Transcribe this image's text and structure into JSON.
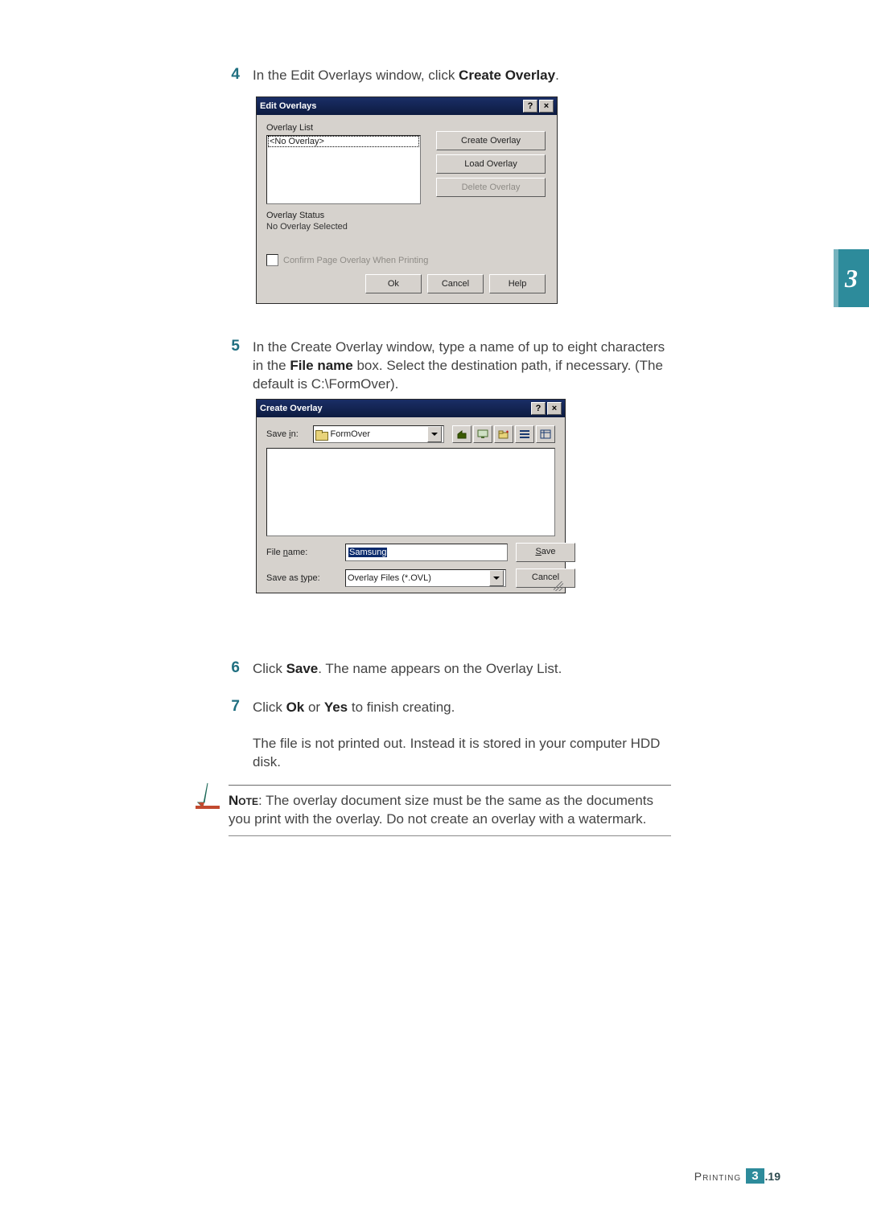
{
  "chapter_tab": "3",
  "steps": {
    "s4": {
      "num": "4",
      "text_pre": "In the Edit Overlays window, click ",
      "bold": "Create Overlay",
      "text_post": "."
    },
    "s5": {
      "num": "5",
      "text_pre": "In the Create Overlay window, type a name of up to eight characters in the ",
      "bold": "File name",
      "text_post": " box. Select the destination path, if necessary. (The default is C:\\FormOver)."
    },
    "s6": {
      "num": "6",
      "text_pre": "Click ",
      "bold": "Save",
      "text_post": ". The name appears on the Overlay List."
    },
    "s7": {
      "num": "7",
      "text_pre": "Click ",
      "bold1": "Ok",
      "mid": " or ",
      "bold2": "Yes",
      "text_post": " to finish creating."
    },
    "s7b": {
      "text": "The file is not printed out. Instead it is stored in your computer HDD disk."
    }
  },
  "dlg1": {
    "title": "Edit Overlays",
    "overlay_list_label": "Overlay List",
    "overlay_list_items": [
      "<No Overlay>"
    ],
    "btn_create": "Create Overlay",
    "btn_load": "Load Overlay",
    "btn_delete": "Delete Overlay",
    "status_label": "Overlay Status",
    "status_value": "No Overlay Selected",
    "checkbox_label": "Confirm Page Overlay When Printing",
    "btn_ok": "Ok",
    "btn_cancel": "Cancel",
    "btn_help": "Help"
  },
  "dlg2": {
    "title": "Create Overlay",
    "save_in_label": "Save in:",
    "save_in_value": "FormOver",
    "file_name_label": "File name:",
    "file_name_value": "Samsung",
    "save_as_type_label": "Save as type:",
    "save_as_type_value": "Overlay Files (*.OVL)",
    "btn_save": "Save",
    "btn_cancel": "Cancel"
  },
  "note": {
    "label": "Note",
    "text": ": The overlay document size must be the same as the documents you print with the overlay. Do not create an overlay with a watermark."
  },
  "footer": {
    "section": "Printing",
    "chapter": "3",
    "page": ".19"
  }
}
